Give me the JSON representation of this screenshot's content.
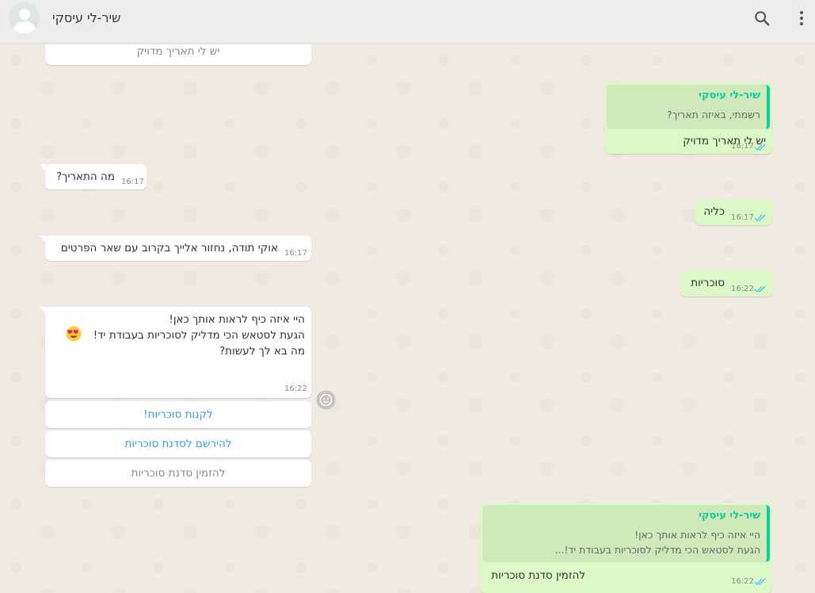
{
  "header": {
    "contact_name": "שיר-לי עיסקי",
    "icons": [
      "avatar",
      "search-icon",
      "menu-icon"
    ]
  },
  "messages": [
    {
      "direction": "in",
      "kind": "quick-reply",
      "text": "יש לי תאריך מדויק"
    },
    {
      "direction": "out",
      "quote_author": "שיר-לי עיסקי",
      "quote_text": "רשמתי, באיזה תאריך?",
      "text": "יש לי תאריך מדויק",
      "time": "16:17",
      "status": "read"
    },
    {
      "direction": "in",
      "text": "מה התאריך?",
      "time": "16:17"
    },
    {
      "direction": "out",
      "text": "כליה",
      "time": "16:17",
      "status": "read"
    },
    {
      "direction": "in",
      "text": "אוקי תודה, נחזור אלייך בקרוב עם שאר הפרטים",
      "time": "16:17"
    },
    {
      "direction": "out",
      "text": "סוכריות",
      "time": "16:22",
      "status": "read"
    },
    {
      "direction": "in",
      "lines": [
        "היי איזה כיף לראות אותך כאן!",
        "הגעת לסטאש הכי מדליק לסוכריות בעבודת יד!",
        "מה בא לך לעשות?"
      ],
      "emoji": "heart-eyes-emoji",
      "time": "16:22"
    },
    {
      "direction": "out",
      "quote_author": "שיר-לי עיסקי",
      "quote_lines": [
        "היי איזה כיף לראות אותך כאן!",
        "הגעת לסטאש הכי מדליק לסוכריות בעבודת יד!..."
      ],
      "text": "להזמין סדנת סוכריות",
      "time": "16:22",
      "status": "read"
    }
  ],
  "quick_replies": [
    "לקנות סוכריות!",
    "להירשם לסדנת סוכריות",
    "להזמין סדנת סוכריות"
  ],
  "colors": {
    "chat_background": "#efeae2",
    "incoming_bubble": "#ffffff",
    "outgoing_bubble": "#dcf8c6",
    "quote_accent": "#06cf9c",
    "read_ticks": "#4fc3f7",
    "link_blue": "#3a9ad9"
  }
}
